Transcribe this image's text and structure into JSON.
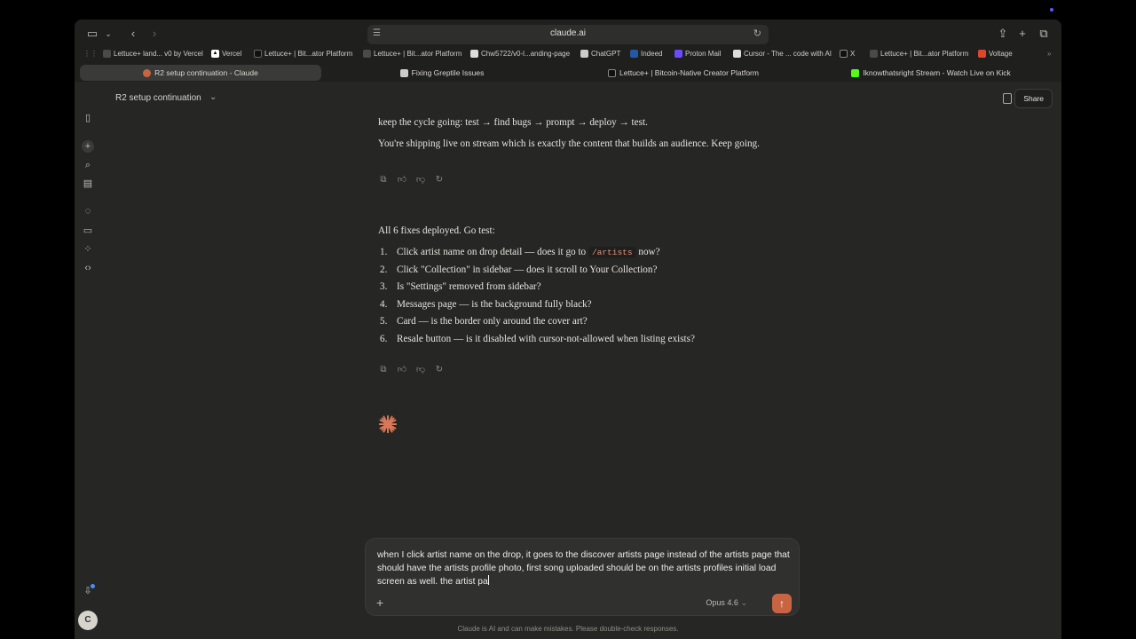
{
  "browser": {
    "url": "claude.ai",
    "bookmarks": [
      "Lettuce+ land... v0 by Vercel",
      "Vercel",
      "Lettuce+ | Bit...ator Platform",
      "Lettuce+ | Bit...ator Platform",
      "Chw5722/v0-l...anding-page",
      "ChatGPT",
      "Indeed",
      "Proton Mail",
      "Cursor - The ... code with AI",
      "X",
      "Lettuce+ | Bit...ator Platform",
      "Voltage"
    ],
    "tabs": [
      "R2 setup continuation - Claude",
      "Fixing Greptile Issues",
      "Lettuce+ | Bitcoin-Native Creator Platform",
      "Iknowthatsright Stream - Watch Live on Kick"
    ]
  },
  "header": {
    "title": "R2 setup continuation",
    "share": "Share"
  },
  "sidebar": {
    "avatar": "C"
  },
  "chat": {
    "prev_line": "keep the cycle going: test → find bugs → prompt → deploy → test.",
    "prev_para": "You're shipping live on stream which is exactly the content that builds an audience. Keep going.",
    "intro": "All 6 fixes deployed. Go test:",
    "items": [
      {
        "n": "1.",
        "a": "Click artist name on drop detail — does it go to ",
        "code": "/artists",
        "b": " now?"
      },
      {
        "n": "2.",
        "a": "Click \"Collection\" in sidebar — does it scroll to Your Collection?"
      },
      {
        "n": "3.",
        "a": "Is \"Settings\" removed from sidebar?"
      },
      {
        "n": "4.",
        "a": "Messages page — is the background fully black?"
      },
      {
        "n": "5.",
        "a": "Card — is the border only around the cover art?"
      },
      {
        "n": "6.",
        "a": "Resale button — is it disabled with cursor-not-allowed when listing exists?"
      }
    ]
  },
  "composer": {
    "text": "when I click artist name on the drop, it goes to the discover artists page instead of the artists page that should have the artists profile photo, first song uploaded should be on the artists profiles initial load screen as well. the artist pa",
    "model": "Opus 4.6",
    "disclaimer": "Claude is AI and can make mistakes. Please double-check responses."
  },
  "colors": {
    "accent": "#c96442",
    "background": "#262624"
  }
}
